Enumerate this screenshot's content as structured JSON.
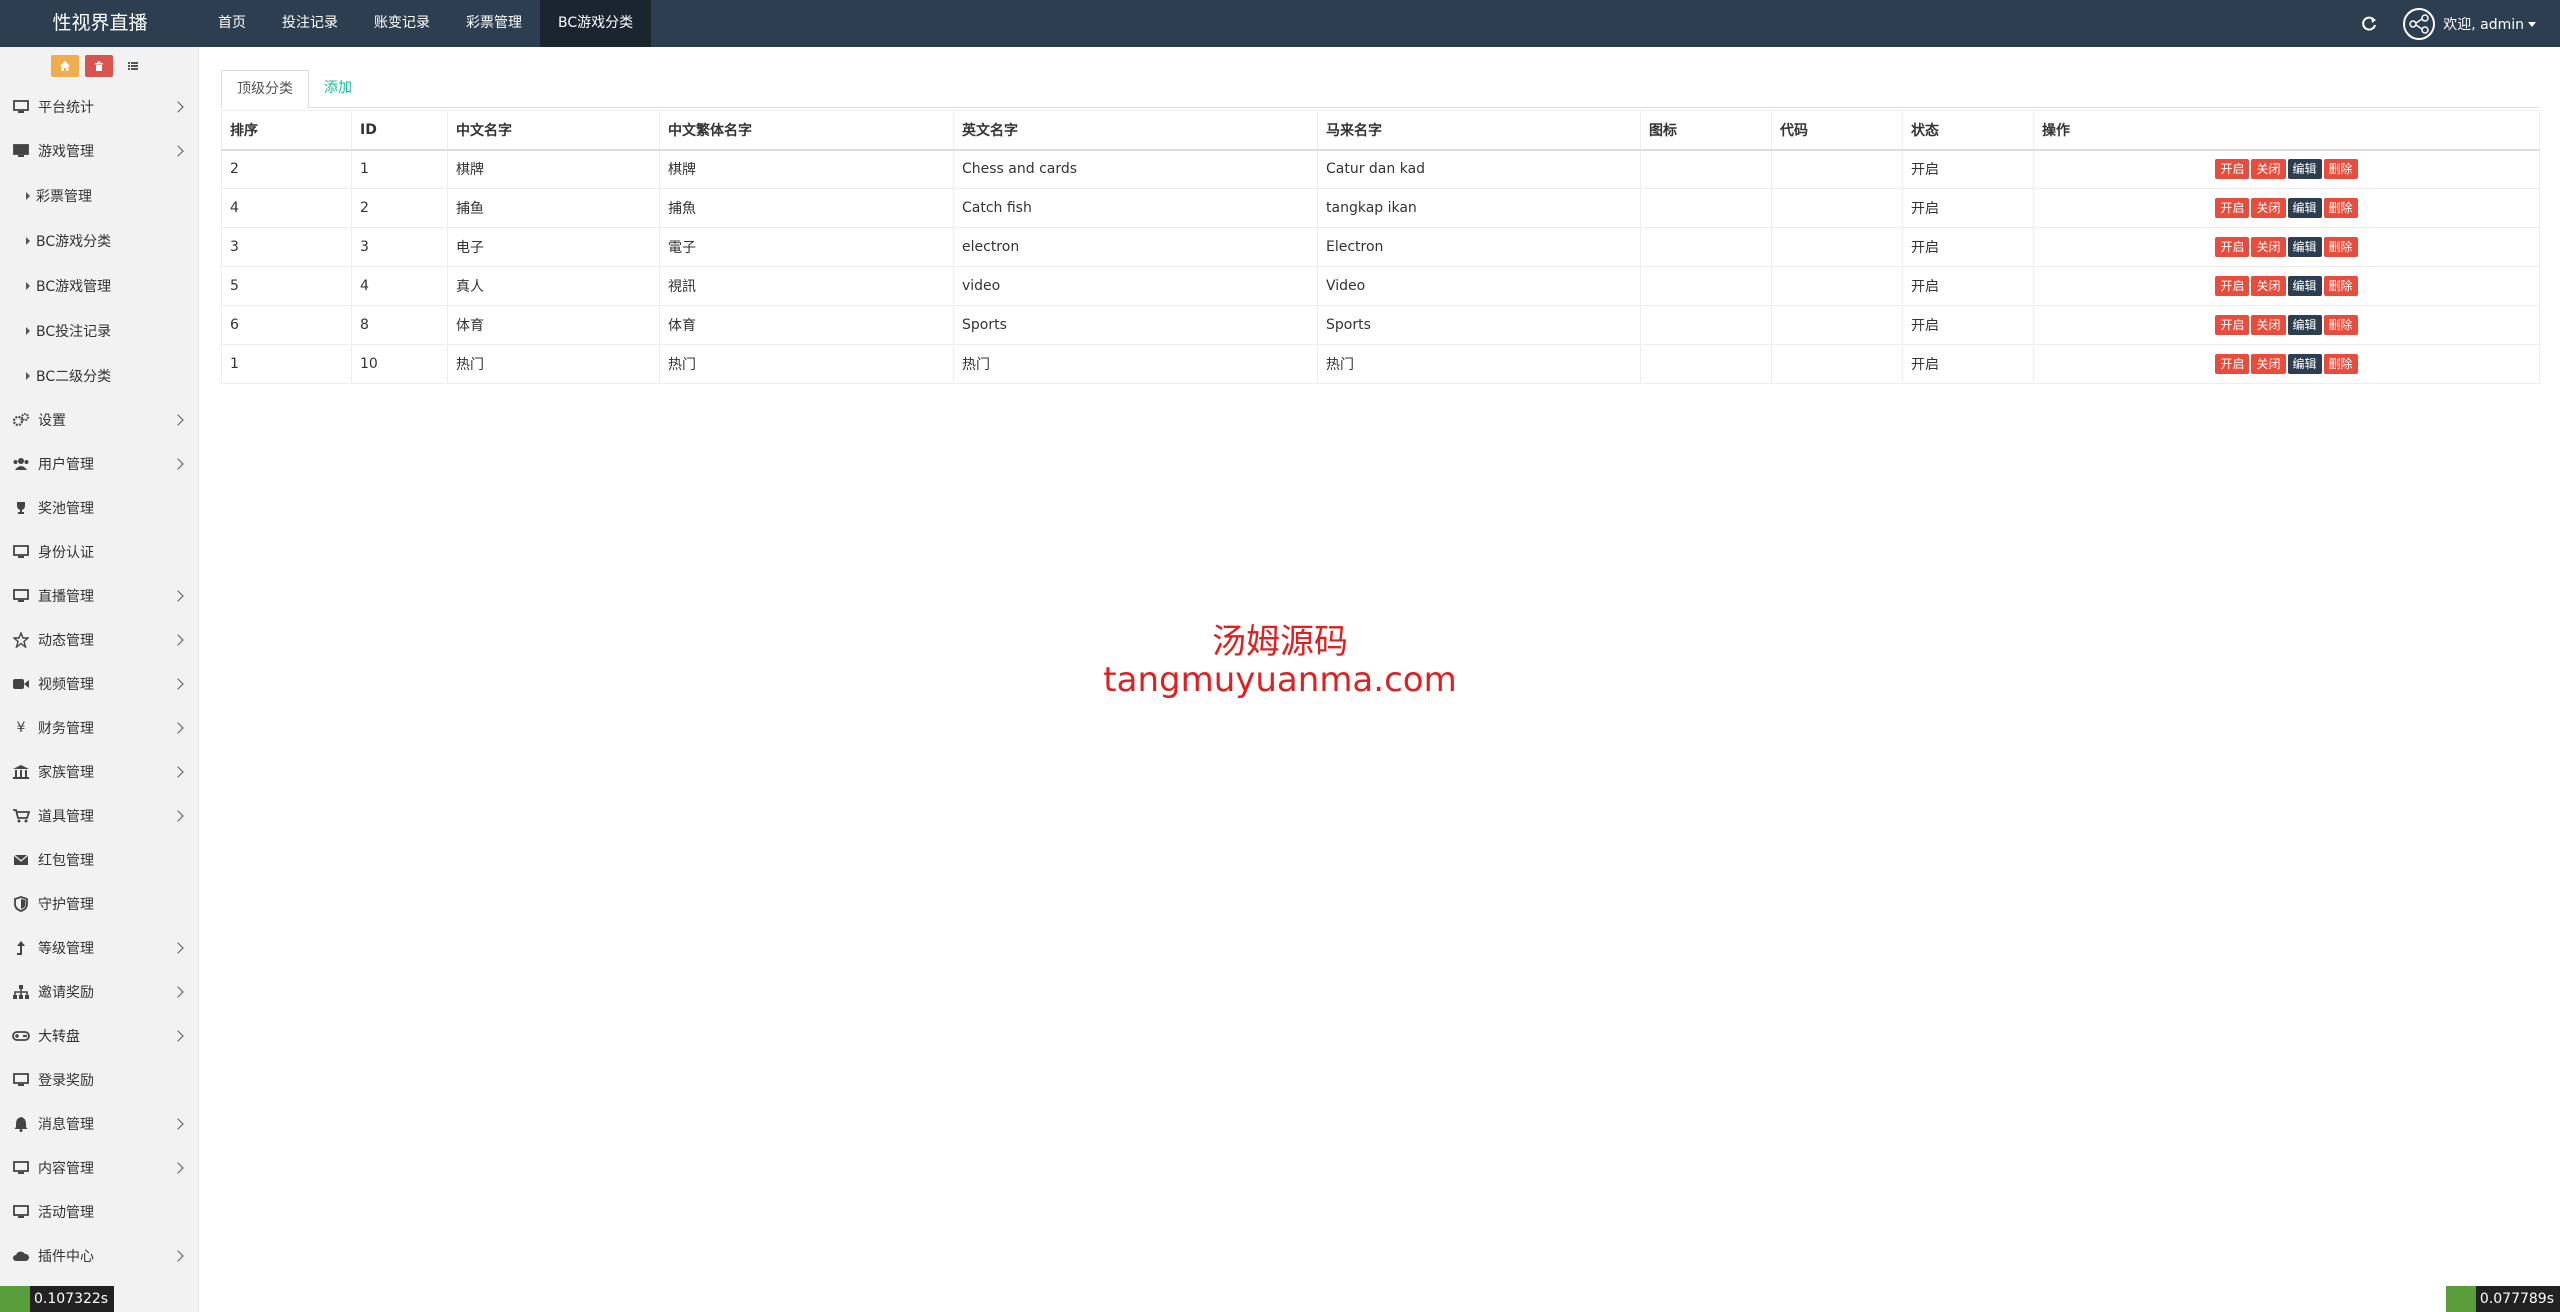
{
  "navbar": {
    "brand": "性视界直播",
    "tabs": [
      {
        "label": "首页"
      },
      {
        "label": "投注记录"
      },
      {
        "label": "账变记录"
      },
      {
        "label": "彩票管理"
      },
      {
        "label": "BC游戏分类"
      }
    ],
    "active_tab": "BC游戏分类",
    "user_greeting": "欢迎, admin"
  },
  "sidebar": {
    "items": [
      {
        "label": "平台统计",
        "icon": "monitor-icon",
        "expandable": true
      },
      {
        "label": "游戏管理",
        "icon": "monitor-icon",
        "expandable": true,
        "expanded": true
      },
      {
        "label": "设置",
        "icon": "gears-icon",
        "expandable": true
      },
      {
        "label": "用户管理",
        "icon": "users-icon",
        "expandable": true
      },
      {
        "label": "奖池管理",
        "icon": "trophy-icon",
        "expandable": false
      },
      {
        "label": "身份认证",
        "icon": "monitor-icon",
        "expandable": false
      },
      {
        "label": "直播管理",
        "icon": "monitor-icon",
        "expandable": true
      },
      {
        "label": "动态管理",
        "icon": "star-icon",
        "expandable": true
      },
      {
        "label": "视频管理",
        "icon": "video-icon",
        "expandable": true
      },
      {
        "label": "财务管理",
        "icon": "yen-icon",
        "expandable": true
      },
      {
        "label": "家族管理",
        "icon": "bank-icon",
        "expandable": true
      },
      {
        "label": "道具管理",
        "icon": "cart-icon",
        "expandable": true
      },
      {
        "label": "红包管理",
        "icon": "envelope-icon",
        "expandable": false
      },
      {
        "label": "守护管理",
        "icon": "shield-icon",
        "expandable": false
      },
      {
        "label": "等级管理",
        "icon": "level-up-icon",
        "expandable": true
      },
      {
        "label": "邀请奖励",
        "icon": "sitemap-icon",
        "expandable": true
      },
      {
        "label": "大转盘",
        "icon": "gamepad-icon",
        "expandable": true
      },
      {
        "label": "登录奖励",
        "icon": "monitor-icon",
        "expandable": false
      },
      {
        "label": "消息管理",
        "icon": "bell-icon",
        "expandable": true
      },
      {
        "label": "内容管理",
        "icon": "monitor-icon",
        "expandable": true
      },
      {
        "label": "活动管理",
        "icon": "monitor-icon",
        "expandable": false
      },
      {
        "label": "插件中心",
        "icon": "cloud-icon",
        "expandable": true
      }
    ],
    "sub_items": [
      {
        "label": "彩票管理"
      },
      {
        "label": "BC游戏分类"
      },
      {
        "label": "BC游戏管理"
      },
      {
        "label": "BC投注记录"
      },
      {
        "label": "BC二级分类"
      }
    ]
  },
  "content": {
    "tabs": [
      {
        "label": "顶级分类"
      },
      {
        "label": "添加"
      }
    ],
    "table": {
      "columns": [
        "排序",
        "ID",
        "中文名字",
        "中文繁体名字",
        "英文名字",
        "马来名字",
        "图标",
        "代码",
        "状态",
        "操作"
      ],
      "rows": [
        {
          "sort": "2",
          "id": "1",
          "cn": "棋牌",
          "tw": "棋牌",
          "en": "Chess and cards",
          "my": "Catur dan kad",
          "icon": "",
          "code": "",
          "status": "开启"
        },
        {
          "sort": "4",
          "id": "2",
          "cn": "捕鱼",
          "tw": "捕魚",
          "en": "Catch fish",
          "my": "tangkap ikan",
          "icon": "",
          "code": "",
          "status": "开启"
        },
        {
          "sort": "3",
          "id": "3",
          "cn": "电子",
          "tw": "電子",
          "en": "electron",
          "my": "Electron",
          "icon": "",
          "code": "",
          "status": "开启"
        },
        {
          "sort": "5",
          "id": "4",
          "cn": "真人",
          "tw": "視訊",
          "en": "video",
          "my": "Video",
          "icon": "",
          "code": "",
          "status": "开启"
        },
        {
          "sort": "6",
          "id": "8",
          "cn": "体育",
          "tw": "体育",
          "en": "Sports",
          "my": "Sports",
          "icon": "",
          "code": "",
          "status": "开启"
        },
        {
          "sort": "1",
          "id": "10",
          "cn": "热门",
          "tw": "热门",
          "en": "热门",
          "my": "热门",
          "icon": "",
          "code": "",
          "status": "开启"
        }
      ],
      "actions": {
        "open": "开启",
        "close": "关闭",
        "edit": "编辑",
        "delete": "删除"
      }
    }
  },
  "watermark": {
    "line1": "汤姆源码",
    "line2": "tangmuyuanma.com"
  },
  "timers": {
    "left": "0.107322s",
    "right": "0.077789s"
  },
  "colors": {
    "navbar": "#2c3e50",
    "danger": "#e74c3c",
    "primary_dark": "#2c3e50",
    "success_link": "#18bc9c",
    "watermark": "#e02020"
  }
}
